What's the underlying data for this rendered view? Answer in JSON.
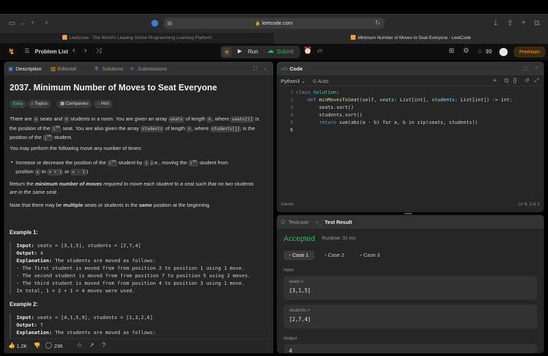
{
  "browser": {
    "url": "leetcode.com",
    "tabs": [
      {
        "title": "LeetCode - The World's Leading Online Programming Learning Platform"
      },
      {
        "title": "Minimum Number of Moves to Seat Everyone - LeetCode"
      }
    ]
  },
  "nav": {
    "problem_list": "Problem List",
    "run": "Run",
    "submit": "Submit",
    "streak": "99",
    "premium": "Premium"
  },
  "left_panel": {
    "tabs": [
      "Description",
      "Editorial",
      "Solutions",
      "Submissions"
    ],
    "title": "2037. Minimum Number of Moves to Seat Everyone",
    "chips": [
      "Easy",
      "Topics",
      "Companies",
      "Hint"
    ],
    "p1": {
      "a": "There are ",
      "n1": "n",
      "b": " seats and ",
      "n2": "n",
      "c": " students in a room. You are given an array ",
      "seats": "seats",
      "d": " of length ",
      "n3": "n",
      "e": ", where ",
      "seats_i": "seats[i]",
      "f": " is",
      "g": "the position of the ",
      "ith": "i",
      "h": " seat. You are also given the array ",
      "students": "students",
      "i": " of length ",
      "n4": "n",
      "j": ", where ",
      "students_j": "students[j]",
      "k": " is the",
      "l": "position of the ",
      "jth": "j",
      "m": " student."
    },
    "p2": "You may perform the following move any number of times:",
    "bullet": {
      "a": "Increase or decrease the position of the ",
      "ith": "i",
      "b": " student by ",
      "one": "1",
      "c": " (i.e., moving the ",
      "ith2": "i",
      "d": " student from",
      "e": "position ",
      "x": "x",
      "f": " to ",
      "x1": "x + 1",
      "g": " or ",
      "x2": "x - 1",
      "h": ")"
    },
    "p3": {
      "a": "Return the ",
      "b": "minimum number of moves",
      "c": " required to move each student to a seat such that no two students",
      "d": "are in the same seat."
    },
    "p4": {
      "a": "Note that there may be ",
      "b": "multiple",
      "c": " seats or students in the ",
      "d": "same",
      "e": " position at the beginning."
    },
    "ex1": {
      "heading": "Example 1:",
      "input_label": "Input:",
      "input": " seats = [3,1,5], students = [2,7,4]",
      "output_label": "Output:",
      "output": " 4",
      "expl_label": "Explanation:",
      "expl": " The students are moved as follows:",
      "lines": [
        "- The first student is moved from from position 2 to position 1 using 1 move.",
        "- The second student is moved from from position 7 to position 5 using 2 moves.",
        "- The third student is moved from from position 4 to position 3 using 1 move.",
        "In total, 1 + 2 + 1 = 4 moves were used."
      ]
    },
    "ex2": {
      "heading": "Example 2:",
      "input_label": "Input:",
      "input": " seats = [4,1,5,9], students = [1,3,2,6]",
      "output_label": "Output:",
      "output": " 7",
      "expl_label": "Explanation:",
      "expl": " The students are moved as follows:"
    },
    "footer": {
      "likes": "1.2K",
      "comments": "236"
    }
  },
  "code_panel": {
    "title": "Code",
    "language": "Python3",
    "mode": "Auto",
    "status": "Saved",
    "cursor": "Ln 6, Col 1",
    "line_numbers": [
      "1",
      "2",
      "3",
      "4",
      "5",
      "6"
    ],
    "lines": {
      "l1a": "class ",
      "l1b": "Solution",
      "l1c": ":",
      "l2a": "    def ",
      "l2b": "minMovesToSeat",
      "l2c": "(self, ",
      "l2d": "seats",
      "l2e": ": List[int], ",
      "l2f": "students",
      "l2g": ": List[int]) -> int:",
      "l3": "        seats.sort()",
      "l4": "        students.sort()",
      "l5a": "        return ",
      "l5b": "sum(abs(a - b) for a, b in zip(seats, students))"
    }
  },
  "result_panel": {
    "tabs": [
      "Testcase",
      "Test Result"
    ],
    "status": "Accepted",
    "runtime": "Runtime: 31 ms",
    "cases": [
      "Case 1",
      "Case 2",
      "Case 3"
    ],
    "input_label": "Input",
    "inputs": [
      {
        "name": "seats =",
        "value": "[3,1,5]"
      },
      {
        "name": "students =",
        "value": "[2,7,4]"
      }
    ],
    "output_label": "Output",
    "output_value": "4"
  },
  "colors": {
    "accent": "#ffa116",
    "accepted": "#2cbb5d",
    "easy": "#46c6c2"
  }
}
